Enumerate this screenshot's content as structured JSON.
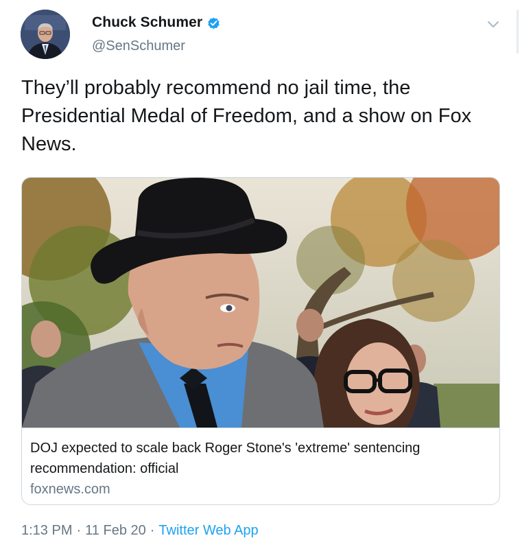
{
  "author": {
    "display_name": "Chuck Schumer",
    "handle": "@SenSchumer",
    "verified": true,
    "avatar_icon": "profile-photo"
  },
  "tweet": {
    "text": "They’ll probably recommend no jail time, the Presidential Medal of Freedom, and a show on Fox News."
  },
  "link_card": {
    "title": "DOJ expected to scale back Roger Stone's 'extreme' sentencing recommendation: official",
    "domain": "foxnews.com",
    "image_icon": "news-photo"
  },
  "meta": {
    "time": "1:13 PM",
    "separator": "·",
    "date": "11 Feb 20",
    "source": "Twitter Web App"
  },
  "colors": {
    "text": "#14171a",
    "secondary": "#657786",
    "accent": "#1da1f2",
    "border": "#ccd6dd"
  }
}
